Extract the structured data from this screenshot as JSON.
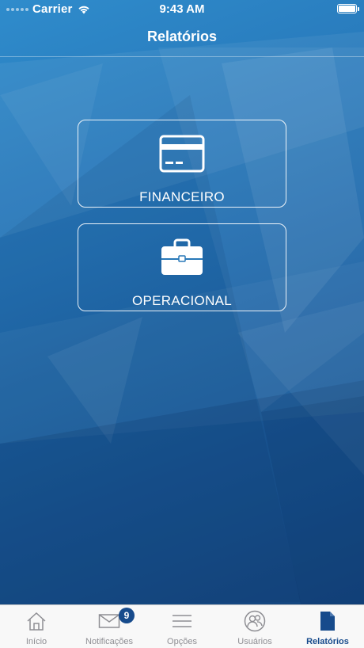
{
  "status_bar": {
    "carrier": "Carrier",
    "time": "9:43 AM"
  },
  "nav": {
    "title": "Relatórios"
  },
  "cards": [
    {
      "label": "FINANCEIRO",
      "icon": "credit-card-icon"
    },
    {
      "label": "OPERACIONAL",
      "icon": "briefcase-icon"
    }
  ],
  "tabs": [
    {
      "label": "Início",
      "icon": "home-icon",
      "active": false
    },
    {
      "label": "Notificações",
      "icon": "envelope-icon",
      "active": false,
      "badge": "9"
    },
    {
      "label": "Opções",
      "icon": "menu-icon",
      "active": false
    },
    {
      "label": "Usuários",
      "icon": "users-icon",
      "active": false
    },
    {
      "label": "Relatórios",
      "icon": "document-icon",
      "active": true
    }
  ],
  "colors": {
    "accent": "#174b8c",
    "inactive_tab": "#8e8e93",
    "background_top": "#2f8ccc",
    "background_bottom": "#174d88"
  }
}
